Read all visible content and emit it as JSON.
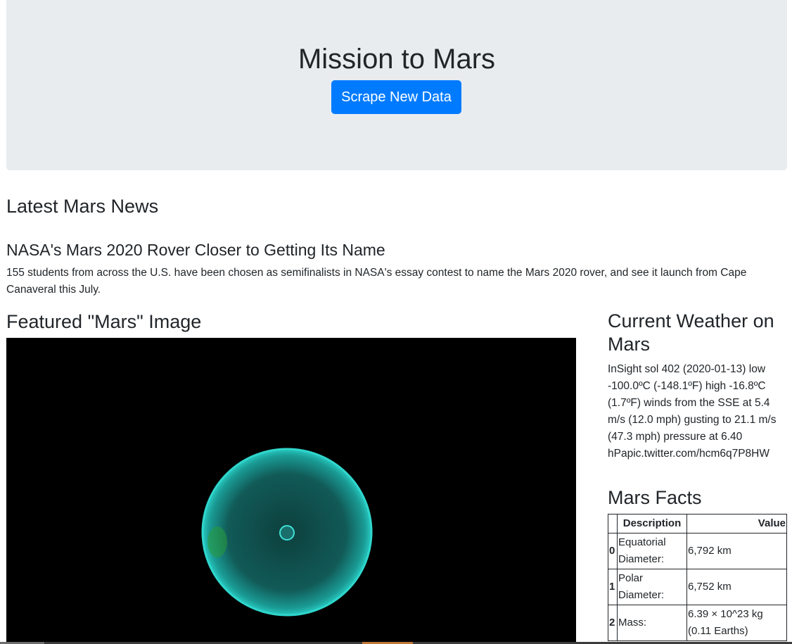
{
  "jumbotron": {
    "title": "Mission to Mars",
    "scrape_button": "Scrape New Data"
  },
  "news": {
    "section_title": "Latest Mars News",
    "article_title": "NASA's Mars 2020 Rover Closer to Getting Its Name",
    "article_body": "155 students from across the U.S. have been chosen as semifinalists in NASA's essay contest to name the Mars 2020 rover, and see it launch from Cape Canaveral this July."
  },
  "featured": {
    "title": "Featured \"Mars\" Image"
  },
  "weather": {
    "title": "Current Weather on Mars",
    "text": "InSight sol 402 (2020-01-13) low -100.0ºC (-148.1ºF) high -16.8ºC (1.7ºF) winds from the SSE at 5.4 m/s (12.0 mph) gusting to 21.1 m/s (47.3 mph) pressure at 6.40 hPapic.twitter.com/hcm6q7P8HW"
  },
  "facts": {
    "title": "Mars Facts",
    "headers": [
      "",
      "Description",
      "Value"
    ],
    "rows": [
      {
        "index": "0",
        "description": "Equatorial Diameter:",
        "value": "6,792 km"
      },
      {
        "index": "1",
        "description": "Polar Diameter:",
        "value": "6,752 km"
      },
      {
        "index": "2",
        "description": "Mass:",
        "value": "6.39 × 10^23 kg (0.11 Earths)"
      }
    ]
  },
  "colors": {
    "primary": "#007bff",
    "jumbotron_bg": "#e9ecef",
    "planet_cyan": "#1fb7b0"
  }
}
